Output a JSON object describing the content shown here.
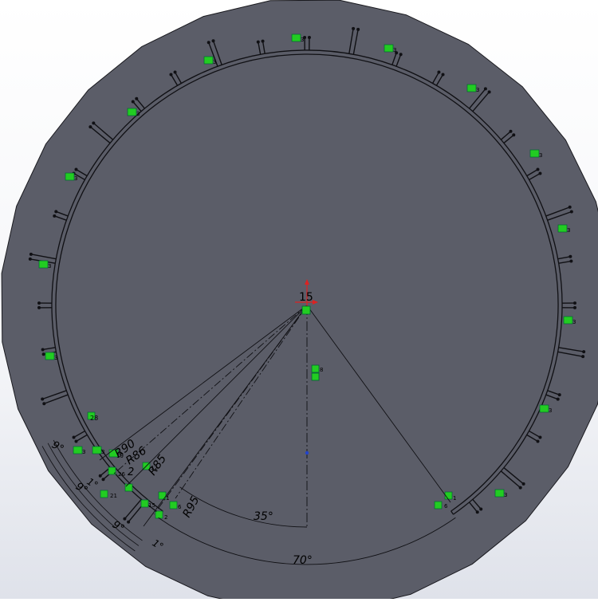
{
  "app": "SolidWorks Sketch",
  "colors": {
    "face": "#5b5d68",
    "edge": "#1a1a1f",
    "sketch": "#101014",
    "relation": "#22cc22",
    "origin_red": "#dd2222",
    "origin_blue": "#2244cc"
  },
  "sketch": {
    "tooth_count": 36,
    "tooth_pitch_deg": 10,
    "tooth_width_deg": 1
  },
  "dimensions": {
    "origin_label": "15",
    "angle_small": "35°",
    "angle_large": "70°",
    "r95": "R95",
    "r90": "R90",
    "r86": "R86",
    "r85": "R85",
    "pitch_a": "9°",
    "pitch_b": "9°",
    "pitch_c": "9°",
    "width_a": "1°",
    "width_b": "1°",
    "count_2": "2"
  },
  "relations": {
    "eq3": "3",
    "eq28": "28",
    "eq21": "21",
    "eq15": "15",
    "eq1": "1",
    "eq6": "6",
    "eq8": "8",
    "eq12": "12",
    "eq19": "19",
    "eq26": "26",
    "eq2": "2"
  }
}
